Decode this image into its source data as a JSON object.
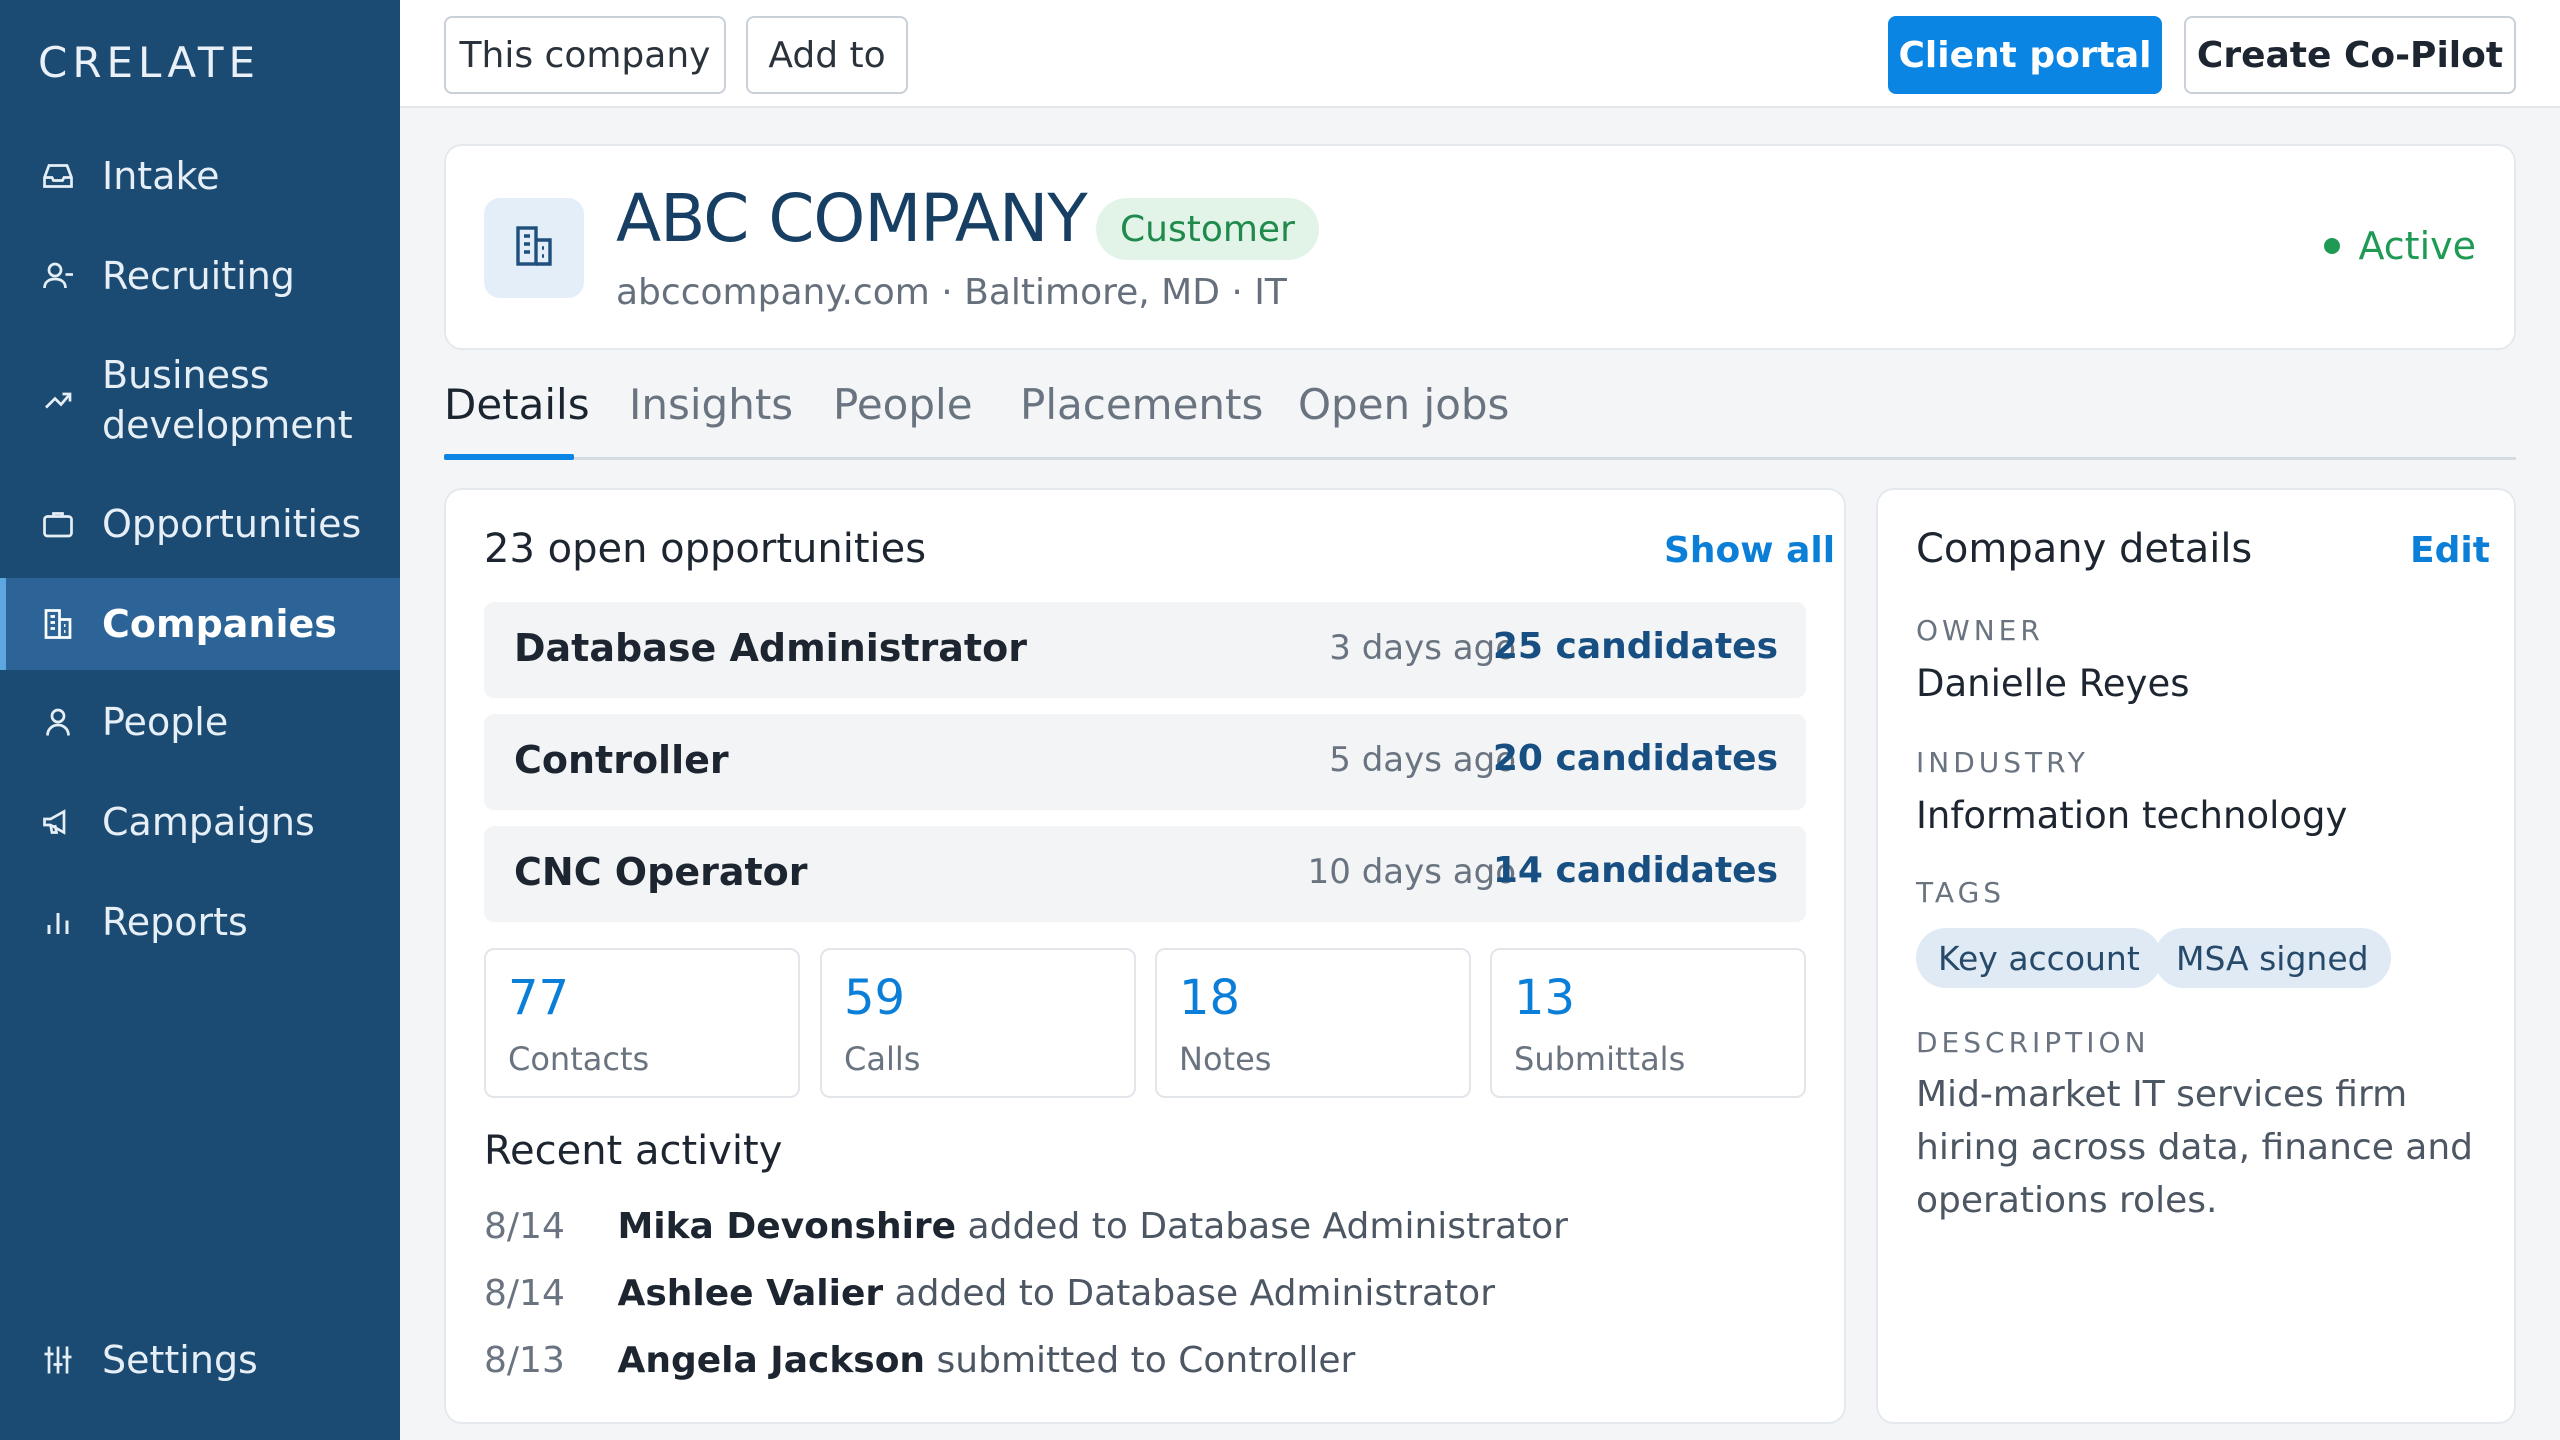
{
  "app": {
    "logo": "CRELATE"
  },
  "sidebar": {
    "items": [
      {
        "label": "Intake",
        "icon": "inbox-icon"
      },
      {
        "label": "Recruiting",
        "icon": "user-icon"
      },
      {
        "label": "Business development",
        "icon": "trend-up-icon"
      },
      {
        "label": "Opportunities",
        "icon": "briefcase-icon"
      },
      {
        "label": "Companies",
        "icon": "building-icon",
        "active": true
      },
      {
        "label": "People",
        "icon": "person-icon"
      },
      {
        "label": "Campaigns",
        "icon": "megaphone-icon"
      },
      {
        "label": "Reports",
        "icon": "bar-chart-icon"
      }
    ],
    "settings": {
      "label": "Settings",
      "icon": "sliders-icon"
    }
  },
  "toolbar": {
    "this_company": "This company",
    "add_to": "Add to",
    "client_portal": "Client portal",
    "copilot": "Create Co-Pilot"
  },
  "company": {
    "name": "ABC COMPANY",
    "badge": "Customer",
    "meta": "abccompany.com · Baltimore, MD · IT",
    "status": "Active"
  },
  "tabs": [
    "Details",
    "Insights",
    "People",
    "Placements",
    "Open jobs"
  ],
  "opportunities": {
    "title": "23 open opportunities",
    "show_all": "Show all",
    "rows": [
      {
        "title": "Database Administrator",
        "age": "3 days ago",
        "candidates": "25 candidates"
      },
      {
        "title": "Controller",
        "age": "5 days ago",
        "candidates": "20 candidates"
      },
      {
        "title": "CNC Operator",
        "age": "10 days ago",
        "candidates": "14 candidates"
      }
    ]
  },
  "stats": [
    {
      "value": "77",
      "label": "Contacts"
    },
    {
      "value": "59",
      "label": "Calls"
    },
    {
      "value": "18",
      "label": "Notes"
    },
    {
      "value": "13",
      "label": "Submittals"
    }
  ],
  "activity": {
    "title": "Recent activity",
    "items": [
      {
        "date": "8/14",
        "name": "Mika Devonshire",
        "text": "added to Database Administrator"
      },
      {
        "date": "8/14",
        "name": "Ashlee Valier",
        "text": "added to Database Administrator"
      },
      {
        "date": "8/13",
        "name": "Angela Jackson",
        "text": "submitted to Controller"
      }
    ]
  },
  "details": {
    "title": "Company details",
    "edit": "Edit",
    "owner_label": "OWNER",
    "owner": "Danielle Reyes",
    "industry_label": "INDUSTRY",
    "industry": "Information technology",
    "tags_label": "TAGS",
    "tags": [
      "Key account",
      "MSA signed"
    ],
    "description_label": "DESCRIPTION",
    "description": "Mid-market IT services firm hiring across data, finance and operations roles."
  },
  "colors": {
    "sidebar": "#1b4a72",
    "sidebar_active": "#2c6497",
    "accent": "#0b85e3",
    "active_status": "#1e9a55"
  }
}
